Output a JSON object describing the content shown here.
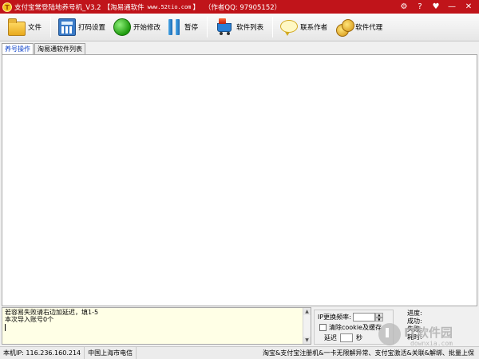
{
  "window": {
    "app_icon_text": "T",
    "title": "支付宝常登陆地养号机_V3.2",
    "brand": "【淘易通软件",
    "url": "www.52tio.com",
    "bracket_close": "】",
    "author": "（作者QQ: 97905152）",
    "buttons": {
      "settings": "⚙",
      "help": "?",
      "skin": "♥",
      "minimize": "—",
      "close": "✕"
    }
  },
  "toolbar": {
    "file": "文件",
    "print_settings": "打码设置",
    "start": "开始修改",
    "pause": "暂停",
    "software_list": "软件列表",
    "contact": "联系作者",
    "agent": "软件代理"
  },
  "tabs": [
    {
      "label": "养号操作",
      "active": true
    },
    {
      "label": "淘易通软件列表",
      "active": false
    }
  ],
  "log": {
    "lines": [
      "若容易失败请右边加延迟，填1-5",
      "本次导入账号0个"
    ]
  },
  "ip_panel": {
    "ip_change_label": "IP更换频率:",
    "ip_change_value": "",
    "clear_cookie_label": "清除cookie及缓存",
    "clear_cookie_checked": false,
    "delay_label": "延迟",
    "delay_value": "",
    "delay_unit": "秒"
  },
  "progress_panel": {
    "progress": "进度:",
    "success": "成功:",
    "failed": "失败:",
    "elapsed": "耗时:"
  },
  "watermark": {
    "main": "IT软件园",
    "sub": "downxia.com"
  },
  "statusbar": {
    "local_ip": "本机IP: 116.236.160.214",
    "location": "中国上海市电信",
    "ad": "淘宝&支付宝注册机&一卡无限解异常、支付宝激活&关联&解绑、批量上保"
  },
  "colors": {
    "titlebar": "#c0141a",
    "active_tab_text": "#0a3fc8",
    "log_bg": "#ffffe6"
  }
}
